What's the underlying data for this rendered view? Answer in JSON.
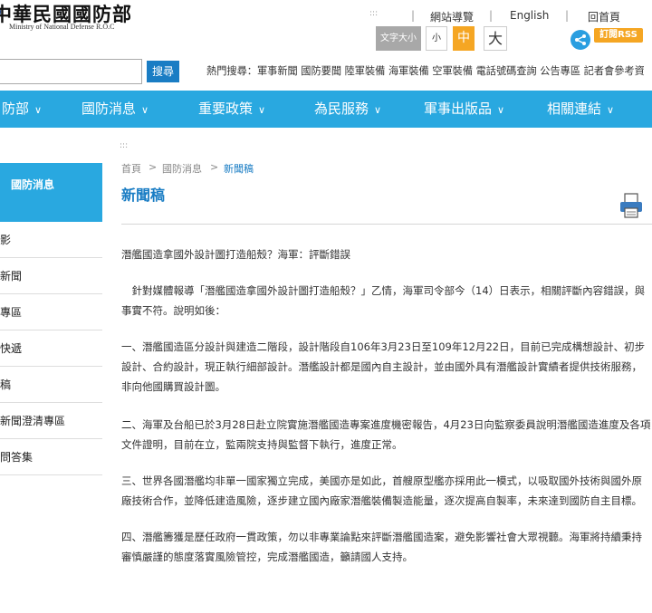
{
  "header": {
    "logo_title": "中華民國國防部",
    "logo_subtitle": "Ministry of National Defense R.O.C",
    "topnav": {
      "dots": ":::",
      "sitemap": "網站導覽",
      "english": "English",
      "home": "回首頁"
    },
    "font_size": {
      "label": "文字大小",
      "small": "小",
      "medium": "中",
      "large": "大"
    },
    "rss": "訂閱RSS"
  },
  "search": {
    "button": "搜尋",
    "hot_label": "熱門搜尋：",
    "hot_links": [
      "軍事新聞",
      "國防要聞",
      "陸軍裝備",
      "海軍裝備",
      "空軍裝備",
      "電話號碼查詢",
      "公告專區",
      "記者會參考資"
    ]
  },
  "mainnav": [
    "防部",
    "國防消息",
    "重要政策",
    "為民服務",
    "軍事出版品",
    "相關連結"
  ],
  "sidebar": {
    "heading": "國防消息",
    "items": [
      "影",
      "新聞",
      "專區",
      "快遞",
      "稿",
      "新聞澄清專區",
      "問答集"
    ]
  },
  "content": {
    "dots": ":::",
    "breadcrumb": [
      "首頁",
      ">",
      "國防消息",
      ">",
      "新聞稿"
    ],
    "page_title": "新聞稿",
    "article": [
      "潛艦國造拿國外設計圖打造船殼？海軍：評斷錯誤",
      "　針對媒體報導「潛艦國造拿國外設計圖打造船殼？」乙情，海軍司令部今（14）日表示，相關評斷內容錯誤，與事實不符。說明如後：",
      "一、潛艦國造區分設計與建造二階段，設計階段自106年3月23日至109年12月22日，目前已完成構想設計、初步設計、合約設計，現正執行細部設計。潛艦設計都是國內自主設計，並由國外具有潛艦設計實績者提供技術服務，非向他國購買設計圖。",
      "二、海軍及台船已於3月28日赴立院實施潛艦國造專案進度機密報告，4月23日向監察委員說明潛艦國造進度及各項文件證明，目前在立，監兩院支持與監督下執行，進度正常。",
      "三、世界各國潛艦均非單一國家獨立完成，美國亦是如此，首艘原型艦亦採用此一模式，以吸取國外技術與國外原廠技術合作，並降低建造風險，逐步建立國內廠家潛艦裝備製造能量，逐次提高自製率，未來達到國防自主目標。",
      "四、潛艦籌獲是歷任政府一貫政策，勿以非專業論點來評斷潛艦國造案，避免影響社會大眾視聽。海軍將持續秉持審慎嚴謹的態度落實風險管控，完成潛艦國造，籲請國人支持。"
    ]
  },
  "icons": {
    "share": "share-icon",
    "print": "print-icon",
    "emblem": "emblem-icon"
  },
  "colors": {
    "accent": "#29a8e0",
    "link": "#1a7dc4",
    "orange": "#f5a623"
  }
}
